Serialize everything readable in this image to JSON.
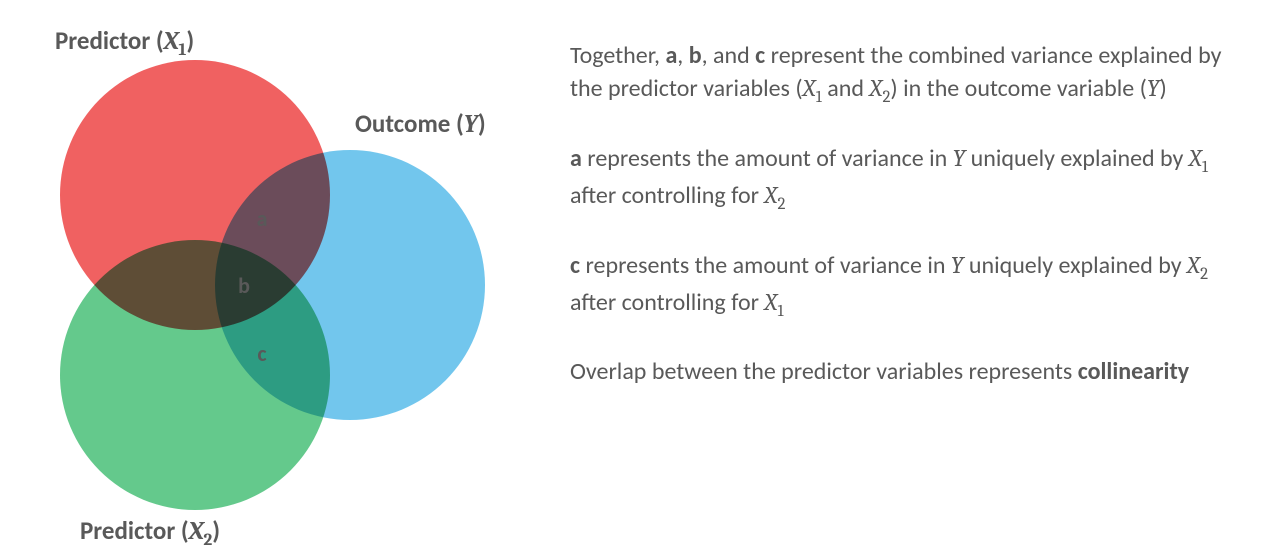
{
  "venn": {
    "labels": {
      "x1": "Predictor (",
      "x1_var": "X",
      "x1_sub": "1",
      "x1_close": ")",
      "x2": "Predictor (",
      "x2_var": "X",
      "x2_sub": "2",
      "x2_close": ")",
      "y": "Outcome (",
      "y_var": "Y",
      "y_close": ")"
    },
    "regions": {
      "a": "a",
      "b": "b",
      "c": "c"
    },
    "colors": {
      "x1": "#EE4B4B",
      "x2": "#4FC27C",
      "y": "#5FBEEA"
    }
  },
  "paragraphs": {
    "p1": {
      "t1": "Together, ",
      "a": "a",
      "t2": ", ",
      "b": "b",
      "t3": ", and ",
      "c": "c",
      "t4": " represent the combined variance explained by the predictor variables (",
      "x1v": "X",
      "x1s": "1",
      "t5": " and ",
      "x2v": "X",
      "x2s": "2",
      "t6": ") in the outcome variable (",
      "yv": "Y",
      "t7": ")"
    },
    "p2": {
      "a": "a",
      "t1": " represents the amount of variance in ",
      "yv": "Y",
      "t2": " uniquely explained by ",
      "x1v": "X",
      "x1s": "1",
      "t3": " after controlling for ",
      "x2v": "X",
      "x2s": "2"
    },
    "p3": {
      "c": "c",
      "t1": " represents the amount of variance in ",
      "yv": "Y",
      "t2": " uniquely explained by ",
      "x2v": "X",
      "x2s": "2",
      "t3": " after controlling for ",
      "x1v": "X",
      "x1s": "1"
    },
    "p4": {
      "t1": "Overlap between the predictor variables represents ",
      "col": "collinearity"
    }
  }
}
